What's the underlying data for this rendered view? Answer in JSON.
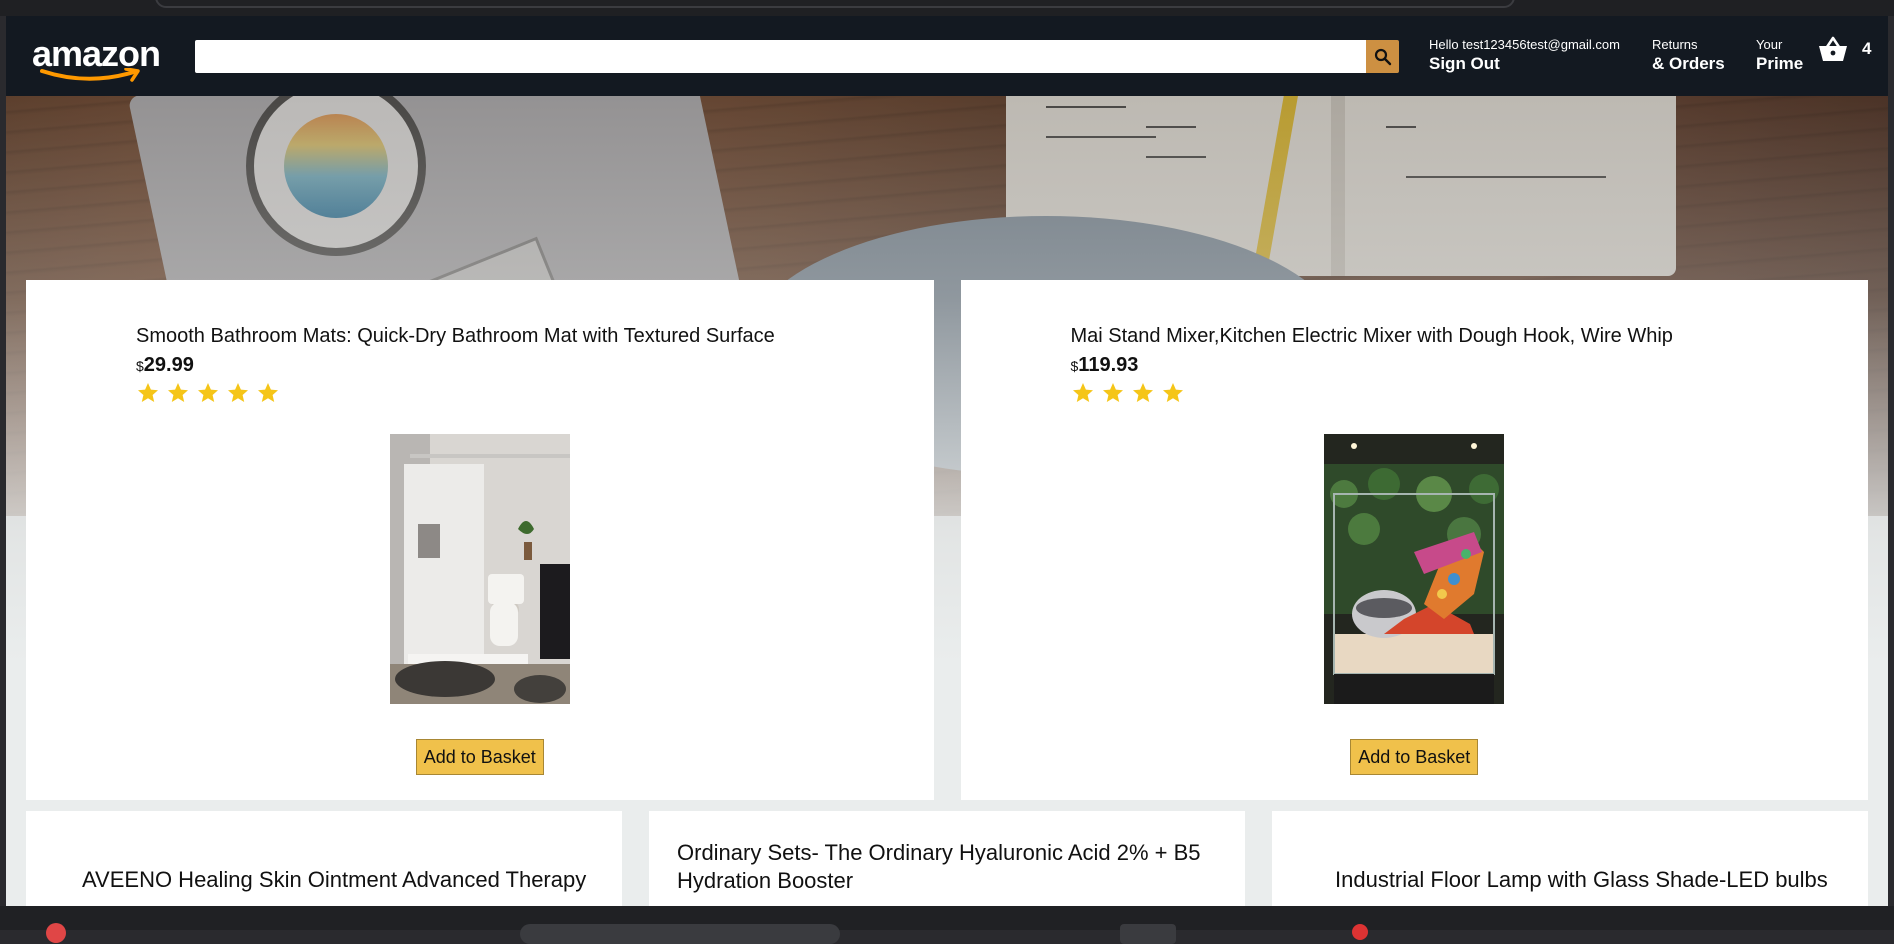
{
  "header": {
    "logo_text": "amazon",
    "search": {
      "value": "",
      "placeholder": ""
    },
    "user": {
      "greeting": "Hello test123456test@gmail.com",
      "action": "Sign Out"
    },
    "returns": {
      "line1": "Returns",
      "line2": "& Orders"
    },
    "prime": {
      "line1": "Your",
      "line2": "Prime"
    },
    "basket": {
      "count": "4"
    },
    "colors": {
      "bg": "#131921",
      "search_button": "#cd9042"
    }
  },
  "products_row1": [
    {
      "title": "Smooth Bathroom Mats: Quick-Dry Bathroom Mat with Textured Surface",
      "currency": "$",
      "price": "29.99",
      "rating": 5,
      "image": "bathroom-photo",
      "button": "Add to Basket"
    },
    {
      "title": "Mai Stand Mixer,Kitchen Electric Mixer with Dough Hook, Wire Whip",
      "currency": "$",
      "price": "119.93",
      "rating": 4,
      "image": "stand-mixer-photo",
      "button": "Add to Basket"
    }
  ],
  "products_row2": [
    {
      "title": "AVEENO Healing Skin Ointment Advanced Therapy"
    },
    {
      "title": "Ordinary Sets- The Ordinary Hyaluronic Acid 2% + B5 Hydration Booster"
    },
    {
      "title": "Industrial Floor Lamp with Glass Shade-LED bulbs"
    }
  ],
  "colors": {
    "star": "#f5c518",
    "button_bg": "#f0c14b",
    "page_bg": "#eaeded"
  }
}
